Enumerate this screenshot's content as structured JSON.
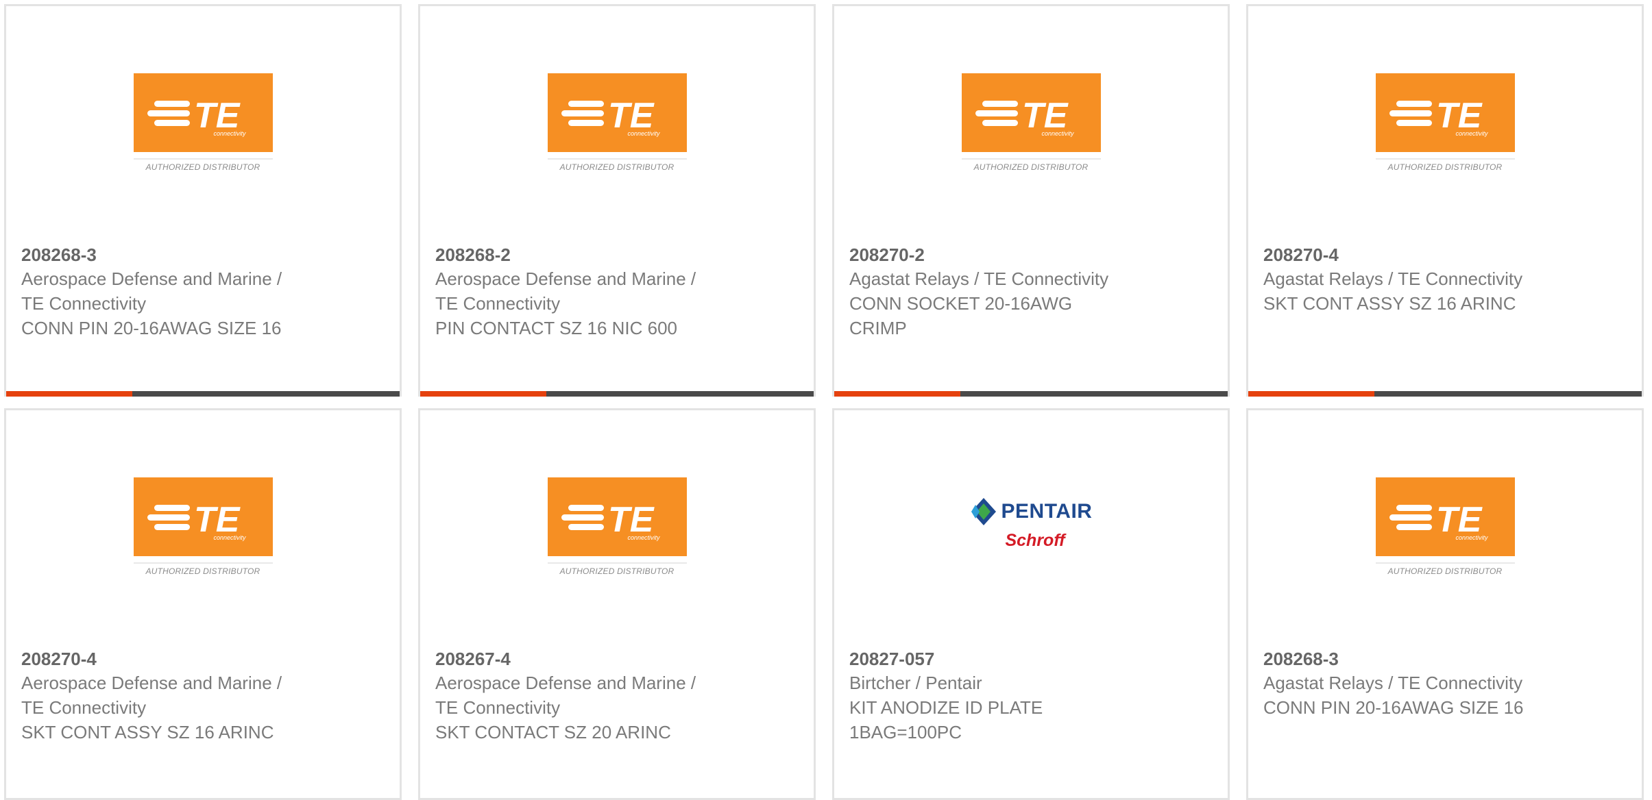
{
  "colors": {
    "te_orange": "#f68f23",
    "bar_accent": "#e5410e",
    "bar_track": "#4a4a4a",
    "pentair_blue": "#1f4a8f",
    "schroff_red": "#d41b26"
  },
  "logos": {
    "te": {
      "wordmark": "TE",
      "sub": "connectivity",
      "caption": "AUTHORIZED DISTRIBUTOR"
    },
    "pentair": {
      "wordmark": "PENTAIR",
      "sub": "Schroff"
    }
  },
  "cards": [
    {
      "part": "208268-3",
      "lines": [
        "Aerospace Defense and Marine /",
        "TE Connectivity",
        "CONN PIN 20-16AWAG SIZE 16"
      ],
      "logo": "te",
      "bar_fraction": 0.32
    },
    {
      "part": "208268-2",
      "lines": [
        "Aerospace Defense and Marine /",
        "TE Connectivity",
        "PIN CONTACT SZ 16 NIC 600"
      ],
      "logo": "te",
      "bar_fraction": 0.32
    },
    {
      "part": "208270-2",
      "lines": [
        "Agastat Relays / TE Connectivity",
        "CONN SOCKET 20-16AWG",
        "CRIMP"
      ],
      "logo": "te",
      "bar_fraction": 0.32
    },
    {
      "part": "208270-4",
      "lines": [
        "Agastat Relays / TE Connectivity",
        "SKT CONT ASSY SZ 16 ARINC",
        ""
      ],
      "logo": "te",
      "bar_fraction": 0.32
    },
    {
      "part": "208270-4",
      "lines": [
        "Aerospace Defense and Marine /",
        "TE Connectivity",
        "SKT CONT ASSY SZ 16 ARINC"
      ],
      "logo": "te",
      "bar_fraction": null
    },
    {
      "part": "208267-4",
      "lines": [
        "Aerospace Defense and Marine /",
        "TE Connectivity",
        "SKT CONTACT SZ 20 ARINC"
      ],
      "logo": "te",
      "bar_fraction": null
    },
    {
      "part": "20827-057",
      "lines": [
        "Birtcher / Pentair",
        "KIT ANODIZE ID PLATE",
        "1BAG=100PC"
      ],
      "logo": "pentair",
      "bar_fraction": null
    },
    {
      "part": "208268-3",
      "lines": [
        "Agastat Relays / TE Connectivity",
        "CONN PIN 20-16AWAG SIZE 16",
        ""
      ],
      "logo": "te",
      "bar_fraction": null
    }
  ]
}
